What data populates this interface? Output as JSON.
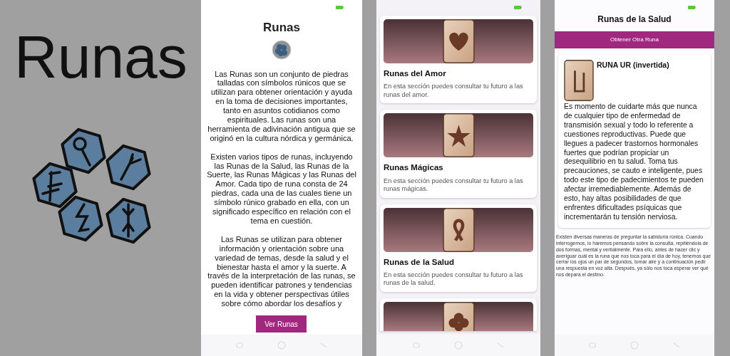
{
  "promo": {
    "title": "Runas"
  },
  "screens": [
    {
      "kind": "intro",
      "title": "Runas",
      "paragraphs": [
        "Las Runas son un conjunto de piedras talladas con símbolos rúnicos que se utilizan para obtener orientación y ayuda en la toma de decisiones importantes, tanto en asuntos cotidianos como espirituales. Las runas son una herramienta de adivinación antigua que se originó en la cultura nórdica y germánica.",
        "Existen varios tipos de runas, incluyendo las Runas de la Salud, las Runas de la Suerte, las Runas Mágicas y las Runas del Amor. Cada tipo de runa consta de 24 piedras, cada una de las cuales tiene un símbolo rúnico grabado en ella, con un significado específico en relación con el tema en cuestión.",
        "Las Runas se utilizan para obtener información y orientación sobre una variedad de temas, desde la salud y el bienestar hasta el amor y la suerte. A través de la interpretación de las runas, se pueden identificar patrones y tendencias en la vida y obtener perspectivas útiles sobre cómo abordar los desafíos y"
      ],
      "button": "Ver Runas"
    },
    {
      "kind": "list",
      "cards": [
        {
          "kind": "full",
          "title": "Runas del Amor",
          "description": "En esta sección puedes consultar tu futuro a las runas del amor."
        },
        {
          "kind": "full",
          "title": "Runas Mágicas",
          "description": "En esta sección puedes consultar tu futuro a las runas mágicas."
        },
        {
          "kind": "full",
          "title": "Runas de la Salud",
          "description": "En esta sección puedes consultar tu futuro a las runas de la salud."
        },
        {
          "kind": "image_only"
        }
      ]
    },
    {
      "kind": "detail",
      "title": "Runas de la Salud",
      "button": "Obtener Otra Runa",
      "rune_title": "RUNA UR (invertida)",
      "reading": "Es momento de cuidarte más que nunca de cualquier tipo de enfermedad de transmisión sexual y todo lo referente a cuestiones reproductivas. Puede que llegues a padecer trastornos hormonales fuertes que podrían propiciar un desequilibrio en tu salud. Toma tus precauciones, se cauto e inteligente, pues todo este tipo de padecimientos te pueden afectar irremediablemente. Además de esto, hay altas posibilidades de que enfrentes dificultades psíquicas que incrementarán tu tensión nerviosa.",
      "note": "Existen diversas maneras de preguntar la sabiduría rúnica. Cuando interrogemos, lo haremos pensando sobre la consulta, repitiéndola de dos formas, mental y verbalmente. Para ello, antes de hacer clic y averiguar cuál es la runa que nos toca para el día de hoy, tenemos que cerrar los ojos un par de segundos, tomar aire y a continuación pedir una respuesta en voz alta. Después, ya sólo nos toca esperar ver qué nos depara el destino."
    }
  ]
}
